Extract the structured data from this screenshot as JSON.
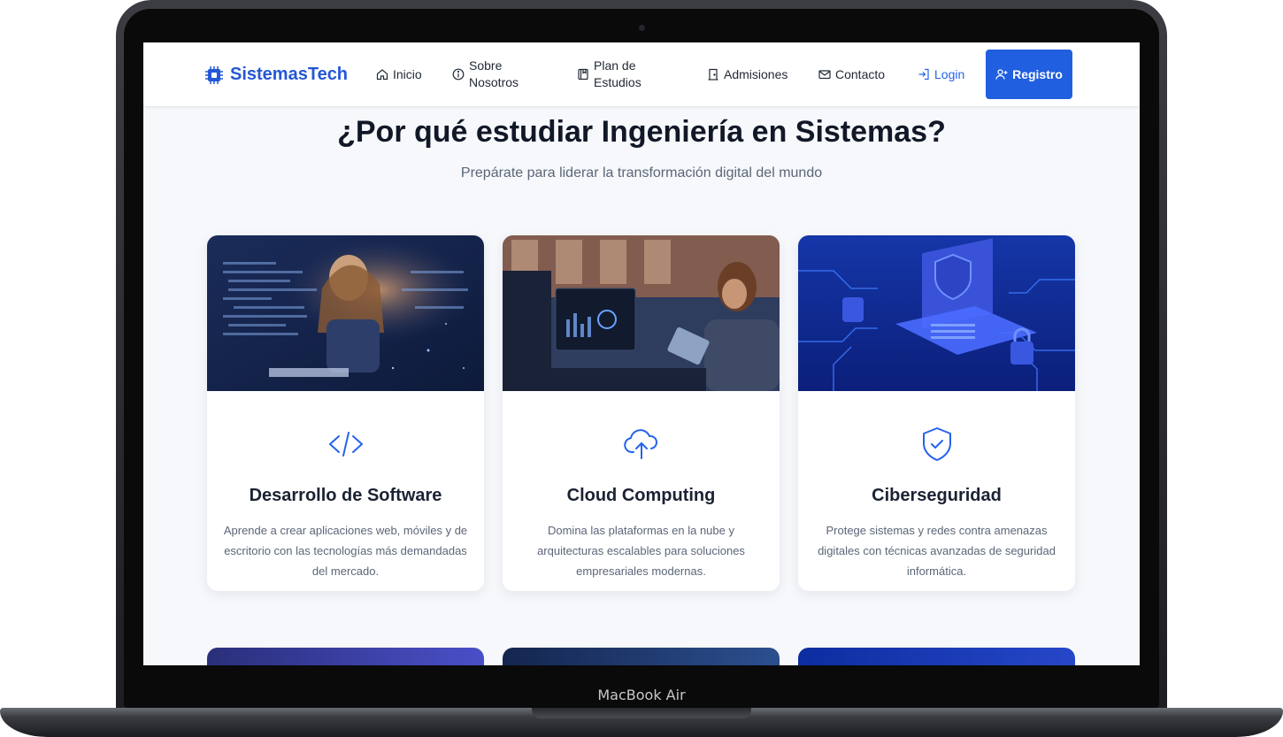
{
  "device": {
    "label": "MacBook Air"
  },
  "nav": {
    "brand": "SistemasTech",
    "items": [
      {
        "label": "Inicio",
        "icon": "home-icon"
      },
      {
        "label": "Sobre Nosotros",
        "icon": "info-icon"
      },
      {
        "label": "Plan de Estudios",
        "icon": "book-icon"
      },
      {
        "label": "Admisiones",
        "icon": "door-icon"
      },
      {
        "label": "Contacto",
        "icon": "envelope-icon"
      },
      {
        "label": "Login",
        "icon": "login-icon"
      }
    ],
    "cta": {
      "label": "Registro",
      "icon": "user-plus-icon"
    }
  },
  "section": {
    "title": "¿Por qué estudiar Ingeniería en Sistemas?",
    "subtitle": "Prepárate para liderar la transformación digital del mundo"
  },
  "cards": [
    {
      "title": "Desarrollo de Software",
      "icon": "code-icon",
      "description": "Aprende a crear aplicaciones web, móviles y de escritorio con las tecnologías más demandadas del mercado."
    },
    {
      "title": "Cloud Computing",
      "icon": "cloud-upload-icon",
      "description": "Domina las plataformas en la nube y arquitecturas escalables para soluciones empresariales modernas."
    },
    {
      "title": "Ciberseguridad",
      "icon": "shield-check-icon",
      "description": "Protege sistemas y redes contra amenazas digitales con técnicas avanzadas de seguridad informática."
    }
  ],
  "colors": {
    "accent": "#2563eb",
    "button": "#1f5fe0",
    "background": "#f6f8fb",
    "title": "#111827",
    "text": "#5b6678"
  }
}
